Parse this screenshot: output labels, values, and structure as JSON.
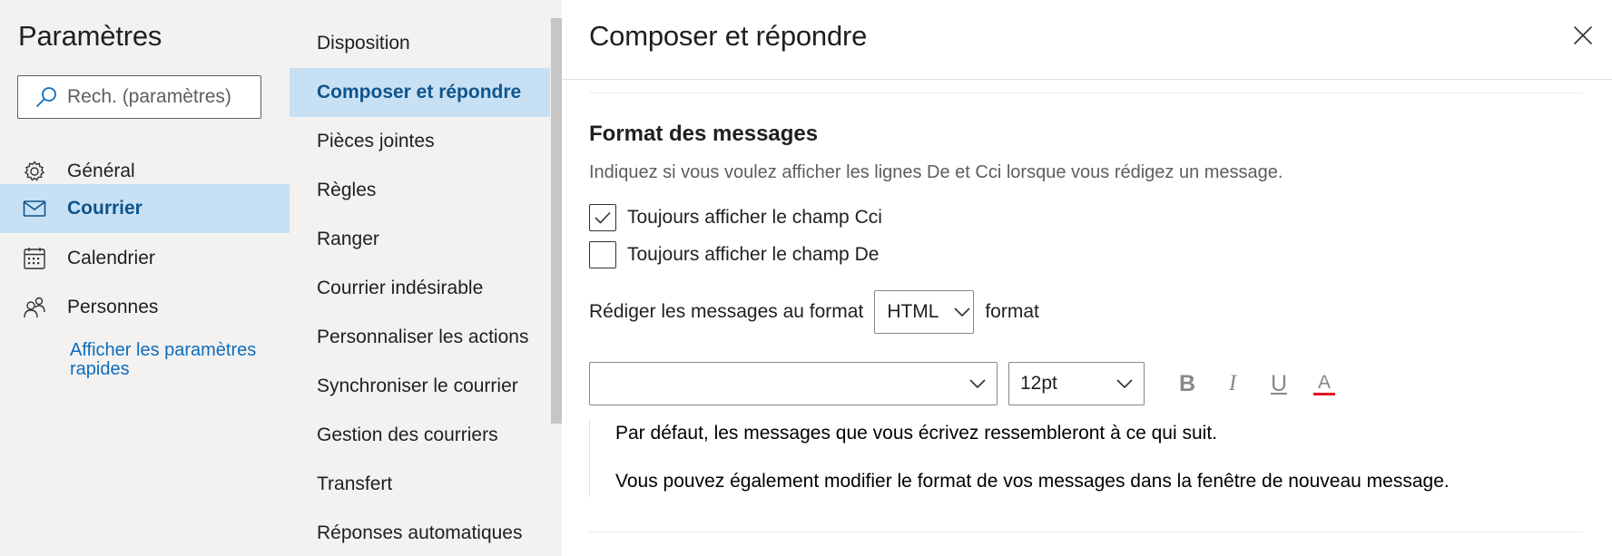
{
  "left": {
    "title": "Paramètres",
    "search": {
      "placeholder": "Rech. (paramètres)"
    },
    "nav": [
      {
        "label": "Général",
        "icon": "gear-icon"
      },
      {
        "label": "Courrier",
        "icon": "mail-icon",
        "active": true
      },
      {
        "label": "Calendrier",
        "icon": "calendar-icon"
      },
      {
        "label": "Personnes",
        "icon": "people-icon"
      }
    ],
    "quick_settings_link": "Afficher les paramètres rapides"
  },
  "middle": {
    "items": [
      "Disposition",
      "Composer et répondre",
      "Pièces jointes",
      "Règles",
      "Ranger",
      "Courrier indésirable",
      "Personnaliser les actions",
      "Synchroniser le courrier",
      "Gestion des courriers",
      "Transfert",
      "Réponses automatiques"
    ],
    "active_index": 1
  },
  "right": {
    "title": "Composer et répondre",
    "section": {
      "title": "Format des messages",
      "description": "Indiquez si vous voulez afficher les lignes De et Cci lorsque vous rédigez un message.",
      "checkbox_bcc": {
        "label": "Toujours afficher le champ Cci",
        "checked": true
      },
      "checkbox_from": {
        "label": "Toujours afficher le champ De",
        "checked": false
      },
      "compose_format": {
        "prefix": "Rédiger les messages au format",
        "value": "HTML",
        "suffix": "format"
      },
      "font_family_value": "",
      "font_size_value": "12pt",
      "toolbar": {
        "bold": "B",
        "italic": "I",
        "underline": "U",
        "font_color": "A"
      },
      "preview_line_1": "Par défaut, les messages que vous écrivez ressembleront à ce qui suit.",
      "preview_line_2": "Vous pouvez également modifier le format de vos messages dans la fenêtre de nouveau message."
    }
  },
  "colors": {
    "accent": "#0f6cbd",
    "selected_bg": "#c7e0f4",
    "pane_bg": "#f3f2f1",
    "font_color_bar": "#e81123"
  }
}
